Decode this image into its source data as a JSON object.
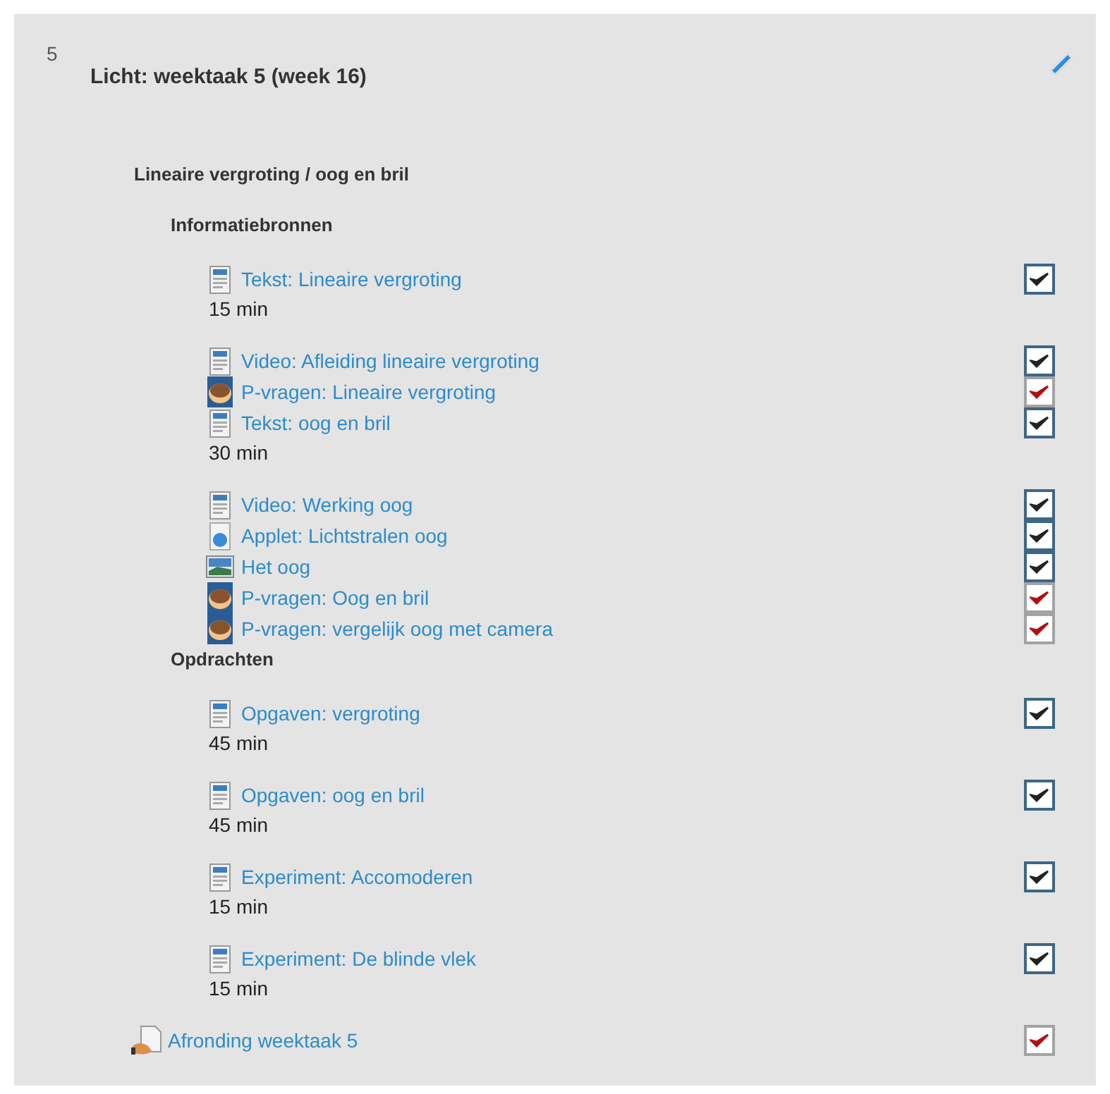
{
  "section": {
    "number": "5",
    "title": "Licht: weektaak 5 (week 16)"
  },
  "topic": "Lineaire vergroting / oog en bril",
  "subsections": [
    {
      "heading": "Informatiebronnen",
      "items": [
        {
          "kind": "page",
          "label": "Tekst: Lineaire vergroting",
          "duration": "15 min",
          "checked": true,
          "color": "#222222"
        },
        {
          "kind": "page",
          "label": "Video: Afleiding lineaire vergroting",
          "checked": true,
          "color": "#222222"
        },
        {
          "kind": "quiz",
          "label": "P-vragen: Lineaire vergroting",
          "checked": true,
          "color": "#b01010"
        },
        {
          "kind": "page",
          "label": "Tekst: oog en bril",
          "duration": "30 min",
          "checked": true,
          "color": "#222222"
        },
        {
          "kind": "page",
          "label": "Video: Werking oog",
          "checked": true,
          "color": "#222222"
        },
        {
          "kind": "applet",
          "label": "Applet: Lichtstralen oog",
          "checked": true,
          "color": "#222222"
        },
        {
          "kind": "image",
          "label": "Het oog",
          "checked": true,
          "color": "#222222"
        },
        {
          "kind": "quiz",
          "label": "P-vragen: Oog en bril",
          "checked": true,
          "color": "#b01010"
        },
        {
          "kind": "quiz",
          "label": "P-vragen: vergelijk oog met camera",
          "checked": true,
          "color": "#b01010"
        }
      ]
    },
    {
      "heading": "Opdrachten",
      "items": [
        {
          "kind": "page",
          "label": "Opgaven: vergroting",
          "duration": "45 min",
          "checked": true,
          "color": "#222222"
        },
        {
          "kind": "page",
          "label": "Opgaven: oog en bril",
          "duration": "45 min",
          "checked": true,
          "color": "#222222"
        },
        {
          "kind": "page",
          "label": "Experiment: Accomoderen",
          "duration": "15 min",
          "checked": true,
          "color": "#222222"
        },
        {
          "kind": "page",
          "label": "Experiment: De blinde vlek",
          "duration": "15 min",
          "checked": true,
          "color": "#222222"
        }
      ]
    }
  ],
  "final_item": {
    "kind": "assignment",
    "label": "Afronding weektaak 5",
    "checked": true,
    "color": "#b01010"
  }
}
